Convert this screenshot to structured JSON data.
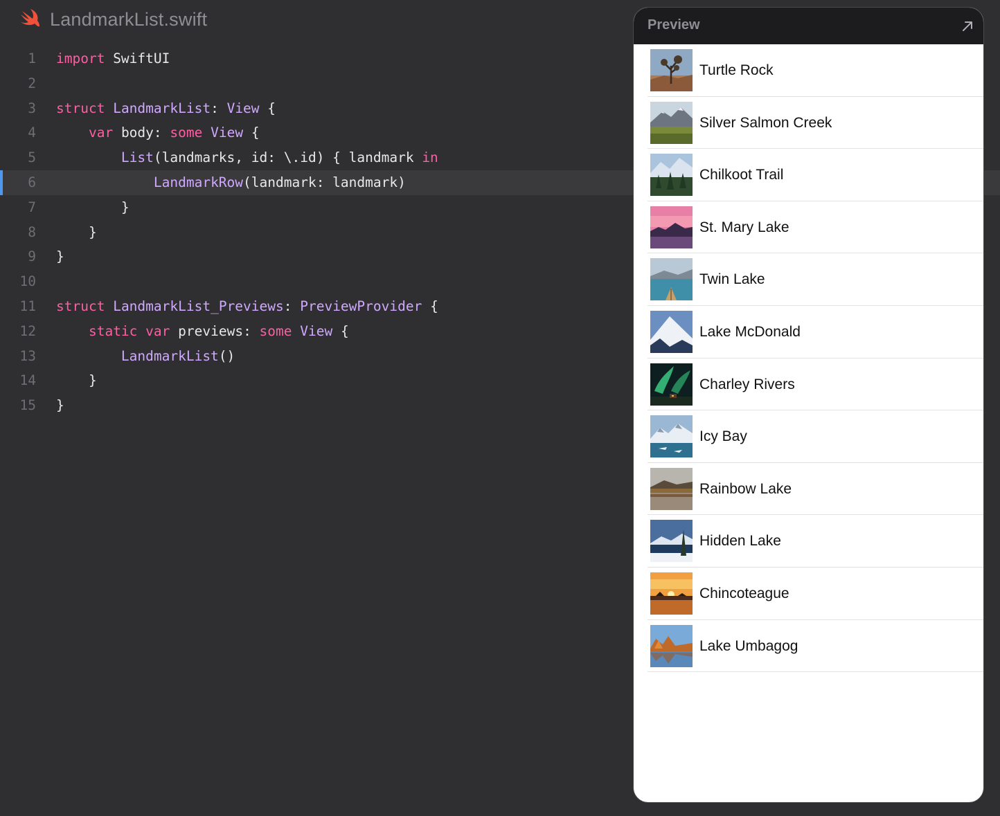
{
  "file": {
    "name": "LandmarkList.swift",
    "icon": "swift-icon"
  },
  "editor": {
    "current_line": 6,
    "colors": {
      "keyword": "#fc5fa3",
      "type": "#d0a8ff",
      "plain": "#e8e8e8",
      "line_number": "#6e6e73",
      "current_line_marker": "#4e98f0"
    },
    "lines": [
      {
        "n": "1",
        "tokens": [
          [
            "kw",
            "import"
          ],
          [
            "plain",
            " SwiftUI"
          ]
        ]
      },
      {
        "n": "2",
        "tokens": []
      },
      {
        "n": "3",
        "tokens": [
          [
            "kw",
            "struct"
          ],
          [
            "plain",
            " "
          ],
          [
            "type",
            "LandmarkList"
          ],
          [
            "plain",
            ": "
          ],
          [
            "type",
            "View"
          ],
          [
            "plain",
            " {"
          ]
        ]
      },
      {
        "n": "4",
        "tokens": [
          [
            "plain",
            "    "
          ],
          [
            "kw",
            "var"
          ],
          [
            "plain",
            " body: "
          ],
          [
            "kw",
            "some"
          ],
          [
            "plain",
            " "
          ],
          [
            "type",
            "View"
          ],
          [
            "plain",
            " {"
          ]
        ]
      },
      {
        "n": "5",
        "tokens": [
          [
            "plain",
            "        "
          ],
          [
            "type",
            "List"
          ],
          [
            "plain",
            "(landmarks, id: \\.id) { landmark "
          ],
          [
            "kw",
            "in"
          ]
        ]
      },
      {
        "n": "6",
        "tokens": [
          [
            "plain",
            "            "
          ],
          [
            "type",
            "LandmarkRow"
          ],
          [
            "plain",
            "(landmark: landmark)"
          ]
        ]
      },
      {
        "n": "7",
        "tokens": [
          [
            "plain",
            "        }"
          ]
        ]
      },
      {
        "n": "8",
        "tokens": [
          [
            "plain",
            "    }"
          ]
        ]
      },
      {
        "n": "9",
        "tokens": [
          [
            "plain",
            "}"
          ]
        ]
      },
      {
        "n": "10",
        "tokens": []
      },
      {
        "n": "11",
        "tokens": [
          [
            "kw",
            "struct"
          ],
          [
            "plain",
            " "
          ],
          [
            "type",
            "LandmarkList_Previews"
          ],
          [
            "plain",
            ": "
          ],
          [
            "type",
            "PreviewProvider"
          ],
          [
            "plain",
            " {"
          ]
        ]
      },
      {
        "n": "12",
        "tokens": [
          [
            "plain",
            "    "
          ],
          [
            "kw",
            "static"
          ],
          [
            "plain",
            " "
          ],
          [
            "kw",
            "var"
          ],
          [
            "plain",
            " previews: "
          ],
          [
            "kw",
            "some"
          ],
          [
            "plain",
            " "
          ],
          [
            "type",
            "View"
          ],
          [
            "plain",
            " {"
          ]
        ]
      },
      {
        "n": "13",
        "tokens": [
          [
            "plain",
            "        "
          ],
          [
            "type",
            "LandmarkList"
          ],
          [
            "plain",
            "()"
          ]
        ]
      },
      {
        "n": "14",
        "tokens": [
          [
            "plain",
            "    }"
          ]
        ]
      },
      {
        "n": "15",
        "tokens": [
          [
            "plain",
            "}"
          ]
        ]
      }
    ]
  },
  "preview": {
    "title": "Preview",
    "expand_icon": "arrow-up-right-icon",
    "landmarks": [
      {
        "name": "Turtle Rock",
        "thumb": "joshua-tree-desert"
      },
      {
        "name": "Silver Salmon Creek",
        "thumb": "mountain-meadow"
      },
      {
        "name": "Chilkoot Trail",
        "thumb": "pine-forest-mountains"
      },
      {
        "name": "St. Mary Lake",
        "thumb": "pink-sunset-lake"
      },
      {
        "name": "Twin Lake",
        "thumb": "canoe-on-lake"
      },
      {
        "name": "Lake McDonald",
        "thumb": "snowy-peak"
      },
      {
        "name": "Charley Rivers",
        "thumb": "aurora-night"
      },
      {
        "name": "Icy Bay",
        "thumb": "glacier-bay"
      },
      {
        "name": "Rainbow Lake",
        "thumb": "reflection-lake"
      },
      {
        "name": "Hidden Lake",
        "thumb": "snowy-tree-lake"
      },
      {
        "name": "Chincoteague",
        "thumb": "orange-sunset-marsh"
      },
      {
        "name": "Lake Umbagog",
        "thumb": "autumn-lake"
      }
    ]
  }
}
